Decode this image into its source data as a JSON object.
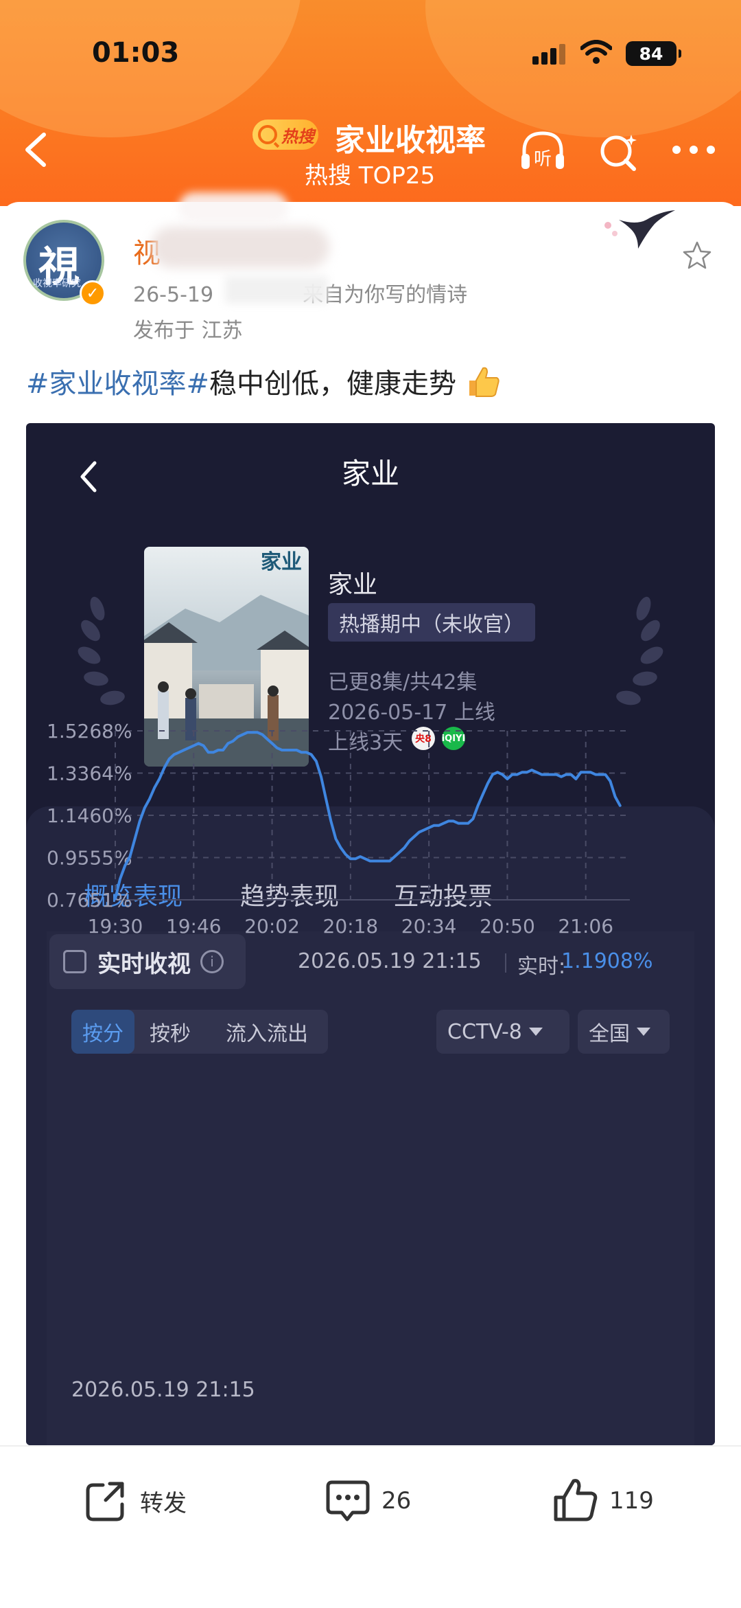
{
  "status_bar": {
    "time": "01:03",
    "battery": "84"
  },
  "nav": {
    "badge": "热搜",
    "title": "家业收视率",
    "subtitle": "热搜 TOP25",
    "listen_label": "听"
  },
  "post": {
    "avatar_char": "視",
    "avatar_caption": "收视率研究",
    "meta": "26-5-19",
    "meta_suffix": "来自为你写的情诗",
    "location": "发布于 江苏",
    "hashtag": "#家业收视率#",
    "text": "稳中创低，健康走势"
  },
  "app": {
    "title": "家业",
    "poster_text": "家业",
    "drama_name": "家业",
    "status": "热播期中（未收官）",
    "episodes": "已更8集/共42集",
    "air_date": "2026-05-17 上线",
    "days_online": "上线3天",
    "channel_cctv": "央8",
    "channel_iqiyi": "iQIYI",
    "tabs": [
      "概览表现",
      "趋势表现",
      "互动投票"
    ],
    "realtime_label": "实时收视",
    "realtime_time": "2026.05.19 21:15",
    "realtime_prefix": "实时:",
    "realtime_value": "1.1908%",
    "modes": [
      "按分",
      "按秒",
      "流入流出"
    ],
    "channel_select": "CCTV-8",
    "region_select": "全国",
    "snapshot_time": "2026.05.19 21:15"
  },
  "chart_data": {
    "type": "line",
    "x_ticks": [
      "19:30",
      "19:46",
      "20:02",
      "20:18",
      "20:34",
      "20:50",
      "21:06"
    ],
    "y_ticks": [
      "1.5268%",
      "1.3364%",
      "1.1460%",
      "0.9555%",
      "0.7651%"
    ],
    "ylim": [
      0.7651,
      1.5268
    ],
    "xlim_minutes": [
      0,
      105
    ],
    "grid": true,
    "line_color": "#3f86e0",
    "points": [
      [
        0,
        0.77
      ],
      [
        1,
        0.86
      ],
      [
        2,
        0.92
      ],
      [
        3,
        0.96
      ],
      [
        4,
        1.04
      ],
      [
        5,
        1.12
      ],
      [
        6,
        1.18
      ],
      [
        7,
        1.22
      ],
      [
        8,
        1.27
      ],
      [
        9,
        1.31
      ],
      [
        10,
        1.36
      ],
      [
        11,
        1.4
      ],
      [
        12,
        1.42
      ],
      [
        13,
        1.43
      ],
      [
        14,
        1.44
      ],
      [
        15,
        1.45
      ],
      [
        16,
        1.46
      ],
      [
        17,
        1.47
      ],
      [
        18,
        1.46
      ],
      [
        19,
        1.43
      ],
      [
        20,
        1.43
      ],
      [
        21,
        1.44
      ],
      [
        22,
        1.44
      ],
      [
        23,
        1.47
      ],
      [
        24,
        1.48
      ],
      [
        25,
        1.5
      ],
      [
        26,
        1.51
      ],
      [
        27,
        1.52
      ],
      [
        28,
        1.52
      ],
      [
        29,
        1.52
      ],
      [
        30,
        1.51
      ],
      [
        31,
        1.49
      ],
      [
        32,
        1.47
      ],
      [
        33,
        1.45
      ],
      [
        34,
        1.44
      ],
      [
        35,
        1.44
      ],
      [
        36,
        1.44
      ],
      [
        37,
        1.44
      ],
      [
        38,
        1.43
      ],
      [
        39,
        1.43
      ],
      [
        40,
        1.42
      ],
      [
        41,
        1.39
      ],
      [
        42,
        1.32
      ],
      [
        43,
        1.22
      ],
      [
        44,
        1.12
      ],
      [
        45,
        1.04
      ],
      [
        46,
        1.0
      ],
      [
        47,
        0.97
      ],
      [
        48,
        0.95
      ],
      [
        49,
        0.95
      ],
      [
        50,
        0.96
      ],
      [
        51,
        0.95
      ],
      [
        52,
        0.94
      ],
      [
        53,
        0.94
      ],
      [
        54,
        0.94
      ],
      [
        55,
        0.94
      ],
      [
        56,
        0.94
      ],
      [
        57,
        0.96
      ],
      [
        58,
        0.98
      ],
      [
        59,
        1.0
      ],
      [
        60,
        1.03
      ],
      [
        61,
        1.05
      ],
      [
        62,
        1.07
      ],
      [
        63,
        1.08
      ],
      [
        64,
        1.09
      ],
      [
        65,
        1.1
      ],
      [
        66,
        1.1
      ],
      [
        67,
        1.11
      ],
      [
        68,
        1.12
      ],
      [
        69,
        1.12
      ],
      [
        70,
        1.11
      ],
      [
        71,
        1.11
      ],
      [
        72,
        1.11
      ],
      [
        73,
        1.13
      ],
      [
        74,
        1.19
      ],
      [
        75,
        1.24
      ],
      [
        76,
        1.29
      ],
      [
        77,
        1.33
      ],
      [
        78,
        1.34
      ],
      [
        79,
        1.33
      ],
      [
        80,
        1.31
      ],
      [
        81,
        1.33
      ],
      [
        82,
        1.33
      ],
      [
        83,
        1.34
      ],
      [
        84,
        1.34
      ],
      [
        85,
        1.35
      ],
      [
        86,
        1.34
      ],
      [
        87,
        1.33
      ],
      [
        88,
        1.33
      ],
      [
        89,
        1.33
      ],
      [
        90,
        1.33
      ],
      [
        91,
        1.32
      ],
      [
        92,
        1.33
      ],
      [
        93,
        1.33
      ],
      [
        94,
        1.31
      ],
      [
        95,
        1.34
      ],
      [
        96,
        1.34
      ],
      [
        97,
        1.34
      ],
      [
        98,
        1.33
      ],
      [
        99,
        1.33
      ],
      [
        100,
        1.33
      ],
      [
        101,
        1.3
      ],
      [
        102,
        1.23
      ],
      [
        103,
        1.19
      ]
    ]
  },
  "actions": {
    "repost": "转发",
    "comments": "26",
    "likes": "119"
  }
}
